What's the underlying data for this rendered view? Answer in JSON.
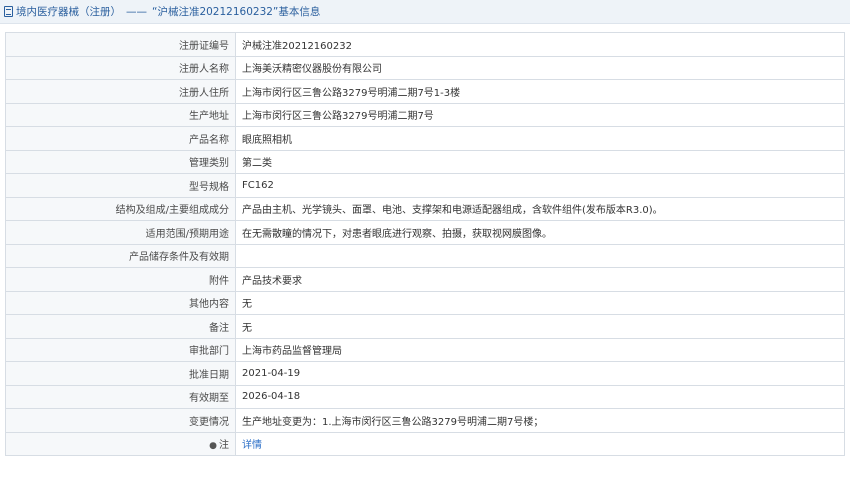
{
  "header": {
    "crumb": "境内医疗器械（注册）",
    "separator": "——",
    "reg_title": "“沪械注准20212160232”基本信息"
  },
  "rows": [
    {
      "label": "注册证编号",
      "value": "沪械注准20212160232"
    },
    {
      "label": "注册人名称",
      "value": "上海美沃精密仪器股份有限公司"
    },
    {
      "label": "注册人住所",
      "value": "上海市闵行区三鲁公路3279号明浦二期7号1-3楼"
    },
    {
      "label": "生产地址",
      "value": "上海市闵行区三鲁公路3279号明浦二期7号"
    },
    {
      "label": "产品名称",
      "value": "眼底照相机"
    },
    {
      "label": "管理类别",
      "value": "第二类"
    },
    {
      "label": "型号规格",
      "value": "FC162"
    },
    {
      "label": "结构及组成/主要组成成分",
      "value": "产品由主机、光学镜头、面罩、电池、支撑架和电源适配器组成，含软件组件(发布版本R3.0)。"
    },
    {
      "label": "适用范围/预期用途",
      "value": "在无需散瞳的情况下，对患者眼底进行观察、拍摄，获取视网膜图像。"
    },
    {
      "label": "产品储存条件及有效期",
      "value": ""
    },
    {
      "label": "附件",
      "value": "产品技术要求"
    },
    {
      "label": "其他内容",
      "value": "无"
    },
    {
      "label": "备注",
      "value": "无"
    },
    {
      "label": "审批部门",
      "value": "上海市药品监督管理局"
    },
    {
      "label": "批准日期",
      "value": "2021-04-19"
    },
    {
      "label": "有效期至",
      "value": "2026-04-18"
    },
    {
      "label": "变更情况",
      "value": "生产地址变更为：1.上海市闵行区三鲁公路3279号明浦二期7号楼；"
    }
  ],
  "note_row": {
    "icon": "pin-icon",
    "label": "注",
    "link": "详情"
  }
}
